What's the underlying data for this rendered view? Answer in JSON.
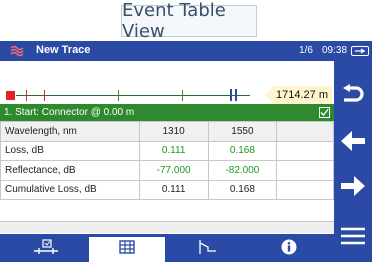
{
  "caption": "Event Table View",
  "titlebar": {
    "app_icon": "trace-waves-icon",
    "title": "New Trace",
    "page": "1/6",
    "time": "09:38",
    "battery_icon": "battery-charging-icon"
  },
  "trace": {
    "distance": "1714.27 m",
    "colors": {
      "start": "#e52323",
      "line": "#2f6b3a",
      "end": "#2b4aa6"
    }
  },
  "event": {
    "header": "1. Start: Connector @ 0.00 m",
    "checked": true
  },
  "table": {
    "header": {
      "label": "Wavelength, nm",
      "values": [
        "1310",
        "1550"
      ]
    },
    "rows": [
      {
        "label": "Loss, dB",
        "values": [
          "0.111",
          "0.168"
        ]
      },
      {
        "label": "Reflectance, dB",
        "values": [
          "-77.000",
          "-82.000"
        ]
      },
      {
        "label": "Cumulative Loss, dB",
        "values": [
          "0.111",
          "0.168"
        ]
      }
    ]
  },
  "bottom_tabs": [
    {
      "icon": "link-map-icon",
      "active": false
    },
    {
      "icon": "table-grid-icon",
      "active": true
    },
    {
      "icon": "trace-graph-icon",
      "active": false
    },
    {
      "icon": "info-icon",
      "active": false
    }
  ],
  "right_nav": [
    "back-icon",
    "previous-arrow-icon",
    "next-arrow-icon",
    "menu-icon"
  ],
  "colors": {
    "brand_blue": "#2b4aa6",
    "event_green": "#2f8a2f"
  }
}
